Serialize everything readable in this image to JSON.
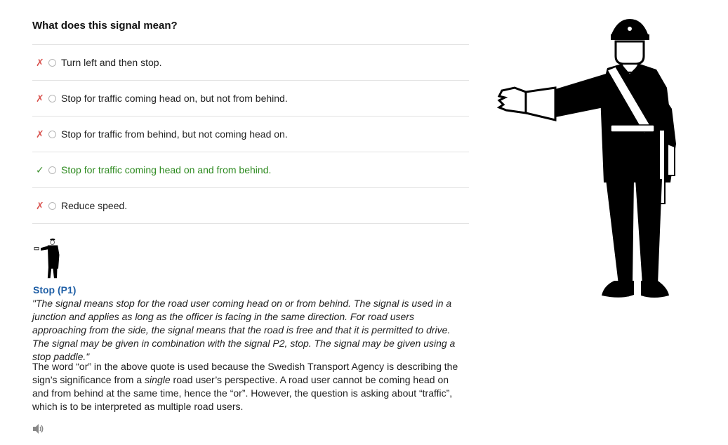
{
  "question": "What does this signal mean?",
  "options": [
    {
      "label": "Turn left and then stop.",
      "mark": "✗",
      "correct": false
    },
    {
      "label": "Stop for traffic coming head on, but not from behind.",
      "mark": "✗",
      "correct": false
    },
    {
      "label": "Stop for traffic from behind, but not coming head on.",
      "mark": "✗",
      "correct": false
    },
    {
      "label": "Stop for traffic coming head on and from behind.",
      "mark": "✓",
      "correct": true
    },
    {
      "label": "Reduce speed.",
      "mark": "✗",
      "correct": false
    }
  ],
  "explanation": {
    "title": "Stop (P1)",
    "quote": "\"The signal means stop for the road user coming head on or from behind. The signal is used in a junction and applies as long as the officer is facing in the same direction. For road users approaching from the side, the signal means that the road is free and that it is permitted to drive. The signal may be given in combination with the signal P2, stop. The signal may be given using a stop paddle.\"",
    "note_part1": "The word “or” in the above quote is used because the Swedish Transport Agency is describing the sign’s significance from a ",
    "note_emphasis": "single",
    "note_part2": " road user’s perspective. A road user cannot be coming head on and from behind at the same time, hence the “or”. However, the question is asking about “traffic”, which is to be interpreted as multiple road users."
  },
  "icons": {
    "speaker": "speaker-icon",
    "officer": "traffic-officer-illustration"
  },
  "colors": {
    "wrong": "#d9534f",
    "correct": "#2d8a1f",
    "title": "#1f5fa6",
    "divider": "#e3e3e3"
  }
}
